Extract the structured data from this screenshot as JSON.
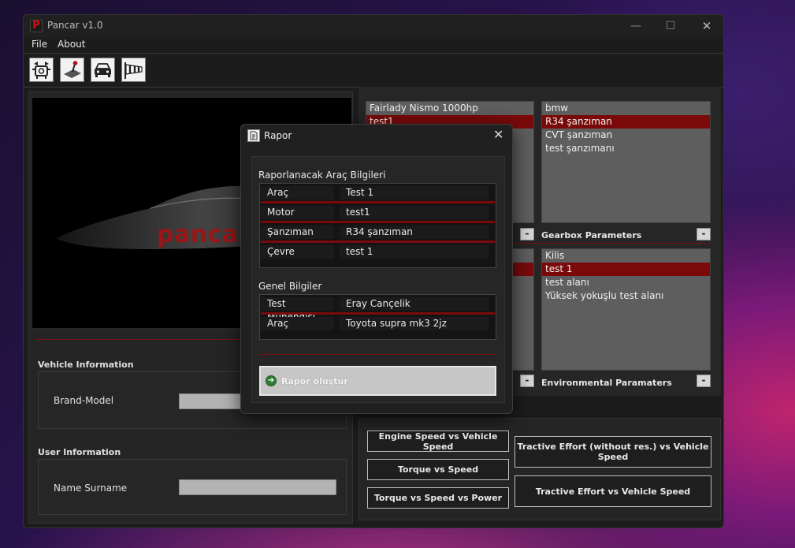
{
  "app": {
    "title": "Pancar v1.0",
    "logo_letter": "P"
  },
  "window_controls": {
    "minimize": "—",
    "maximize": "☐",
    "close": "✕"
  },
  "menu": [
    "File",
    "About"
  ],
  "toolbar": [
    "engine-icon",
    "gear-shifter-icon",
    "car-front-icon",
    "windsock-icon"
  ],
  "car_image": {
    "brand": "pancar"
  },
  "vehicle_info": {
    "title": "Vehicle Information",
    "brand_model_label": "Brand-Model",
    "brand_model_value": ""
  },
  "user_info": {
    "title": "User Information",
    "name_label": "Name Surname",
    "name_value": ""
  },
  "vehicles_list": [
    "Fairlady Nismo 1000hp",
    "test1"
  ],
  "gearbox_list": [
    "bmw",
    "R34 şanzıman",
    "CVT şanzıman",
    "test şanzımanı"
  ],
  "gearbox_label": "Gearbox Parameters",
  "environment_list": [
    "Kilis",
    "test 1",
    "test alanı",
    "Yüksek yokuşlu test alanı"
  ],
  "environment_label": "Environmental Paramaters",
  "minus": "-",
  "graph_buttons": {
    "engine_vs_vehicle": "Engine Speed vs Vehicle Speed",
    "torque_vs_speed": "Torque vs Speed",
    "torque_speed_power": "Torque vs Speed vs Power",
    "tractive_no_res": "Tractive Effort (without res.) vs Vehicle Speed",
    "tractive": "Tractive Effort vs Vehicle Speed"
  },
  "dialog": {
    "title": "Rapor",
    "close": "✕",
    "vehicle_section": "Raporlanacak Araç Bilgileri",
    "vehicle_rows": [
      {
        "key": "Araç",
        "value": "Test 1"
      },
      {
        "key": "Motor",
        "value": "test1"
      },
      {
        "key": "Şanzıman",
        "value": "R34 şanzıman"
      },
      {
        "key": "Çevre",
        "value": "test 1"
      }
    ],
    "general_section": "Genel Bilgiler",
    "general_rows": [
      {
        "key": "Test Mühendisi",
        "value": "Eray Cançelik"
      },
      {
        "key": "Araç",
        "value": "Toyota supra mk3 2jz"
      }
    ],
    "button": "Rapor oluştur"
  },
  "colors": {
    "accent": "#7a0a0a",
    "brand": "#9a1518"
  }
}
